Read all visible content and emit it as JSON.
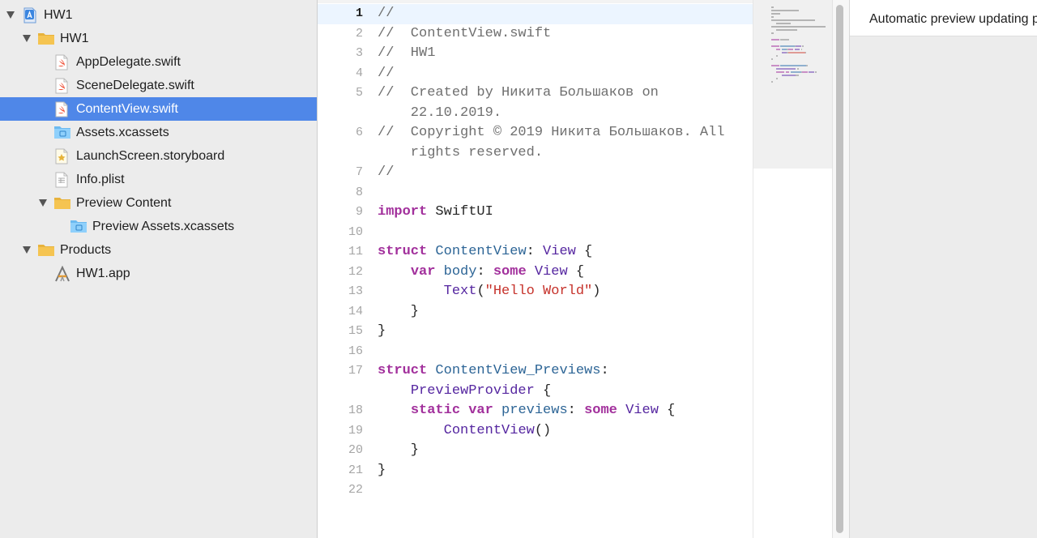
{
  "navigator": {
    "items": [
      {
        "label": "HW1",
        "icon": "project-icon",
        "level": 0,
        "expanded": true
      },
      {
        "label": "HW1",
        "icon": "folder-icon",
        "level": 1,
        "expanded": true
      },
      {
        "label": "AppDelegate.swift",
        "icon": "swift-file-icon",
        "level": 2
      },
      {
        "label": "SceneDelegate.swift",
        "icon": "swift-file-icon",
        "level": 2
      },
      {
        "label": "ContentView.swift",
        "icon": "swift-file-icon",
        "level": 2,
        "selected": true
      },
      {
        "label": "Assets.xcassets",
        "icon": "asset-catalog-icon",
        "level": 2
      },
      {
        "label": "LaunchScreen.storyboard",
        "icon": "storyboard-icon",
        "level": 2
      },
      {
        "label": "Info.plist",
        "icon": "plist-icon",
        "level": 2
      },
      {
        "label": "Preview Content",
        "icon": "folder-icon",
        "level": 2,
        "expanded": true
      },
      {
        "label": "Preview Assets.xcassets",
        "icon": "asset-catalog-icon",
        "level": 3
      },
      {
        "label": "Products",
        "icon": "folder-icon",
        "level": 1,
        "expanded": true
      },
      {
        "label": "HW1.app",
        "icon": "app-icon",
        "level": 2
      }
    ]
  },
  "editor": {
    "current_line": "1",
    "lines": [
      {
        "num": "1",
        "parts": [
          {
            "t": "//",
            "c": "cm"
          }
        ]
      },
      {
        "num": "2",
        "parts": [
          {
            "t": "//  ContentView.swift",
            "c": "cm"
          }
        ]
      },
      {
        "num": "3",
        "parts": [
          {
            "t": "//  HW1",
            "c": "cm"
          }
        ]
      },
      {
        "num": "4",
        "parts": [
          {
            "t": "//",
            "c": "cm"
          }
        ]
      },
      {
        "num": "5",
        "parts": [
          {
            "t": "//  Created by Никита Большаков on",
            "c": "cm"
          }
        ]
      },
      {
        "num": "",
        "parts": [
          {
            "t": "    22.10.2019.",
            "c": "cm"
          }
        ]
      },
      {
        "num": "6",
        "parts": [
          {
            "t": "//  Copyright © 2019 Никита Большаков. All",
            "c": "cm"
          }
        ]
      },
      {
        "num": "",
        "parts": [
          {
            "t": "    rights reserved.",
            "c": "cm"
          }
        ]
      },
      {
        "num": "7",
        "parts": [
          {
            "t": "//",
            "c": "cm"
          }
        ]
      },
      {
        "num": "8",
        "parts": []
      },
      {
        "num": "9",
        "parts": [
          {
            "t": "import",
            "c": "kw"
          },
          {
            "t": " SwiftUI",
            "c": ""
          }
        ]
      },
      {
        "num": "10",
        "parts": []
      },
      {
        "num": "11",
        "parts": [
          {
            "t": "struct",
            "c": "kw"
          },
          {
            "t": " ",
            "c": ""
          },
          {
            "t": "ContentView",
            "c": "ty"
          },
          {
            "t": ": ",
            "c": ""
          },
          {
            "t": "View",
            "c": "sy"
          },
          {
            "t": " {",
            "c": ""
          }
        ]
      },
      {
        "num": "12",
        "parts": [
          {
            "t": "    ",
            "c": ""
          },
          {
            "t": "var",
            "c": "kw"
          },
          {
            "t": " ",
            "c": ""
          },
          {
            "t": "body",
            "c": "ty"
          },
          {
            "t": ": ",
            "c": ""
          },
          {
            "t": "some",
            "c": "kw"
          },
          {
            "t": " ",
            "c": ""
          },
          {
            "t": "View",
            "c": "sy"
          },
          {
            "t": " {",
            "c": ""
          }
        ]
      },
      {
        "num": "13",
        "parts": [
          {
            "t": "        ",
            "c": ""
          },
          {
            "t": "Text",
            "c": "sy"
          },
          {
            "t": "(",
            "c": ""
          },
          {
            "t": "\"Hello World\"",
            "c": "st"
          },
          {
            "t": ")",
            "c": ""
          }
        ]
      },
      {
        "num": "14",
        "parts": [
          {
            "t": "    }",
            "c": ""
          }
        ]
      },
      {
        "num": "15",
        "parts": [
          {
            "t": "}",
            "c": ""
          }
        ]
      },
      {
        "num": "16",
        "parts": []
      },
      {
        "num": "17",
        "parts": [
          {
            "t": "struct",
            "c": "kw"
          },
          {
            "t": " ",
            "c": ""
          },
          {
            "t": "ContentView_Previews",
            "c": "ty"
          },
          {
            "t": ":",
            "c": ""
          }
        ]
      },
      {
        "num": "",
        "parts": [
          {
            "t": "    ",
            "c": ""
          },
          {
            "t": "PreviewProvider",
            "c": "sy"
          },
          {
            "t": " {",
            "c": ""
          }
        ]
      },
      {
        "num": "18",
        "parts": [
          {
            "t": "    ",
            "c": ""
          },
          {
            "t": "static",
            "c": "kw"
          },
          {
            "t": " ",
            "c": ""
          },
          {
            "t": "var",
            "c": "kw"
          },
          {
            "t": " ",
            "c": ""
          },
          {
            "t": "previews",
            "c": "ty"
          },
          {
            "t": ": ",
            "c": ""
          },
          {
            "t": "some",
            "c": "kw"
          },
          {
            "t": " ",
            "c": ""
          },
          {
            "t": "View",
            "c": "sy"
          },
          {
            "t": " {",
            "c": ""
          }
        ]
      },
      {
        "num": "19",
        "parts": [
          {
            "t": "        ",
            "c": ""
          },
          {
            "t": "ContentView",
            "c": "sy"
          },
          {
            "t": "()",
            "c": ""
          }
        ]
      },
      {
        "num": "20",
        "parts": [
          {
            "t": "    }",
            "c": ""
          }
        ]
      },
      {
        "num": "21",
        "parts": [
          {
            "t": "}",
            "c": ""
          }
        ]
      },
      {
        "num": "22",
        "parts": []
      }
    ]
  },
  "preview": {
    "banner_text": "Automatic preview updating paused"
  },
  "colors": {
    "selection": "#4f87e8",
    "keyword": "#a2309c",
    "type_decl": "#2d6596",
    "type_ref": "#5526a0",
    "string": "#c6322b",
    "comment": "#6f6f6f",
    "folder": "#f5c451"
  }
}
